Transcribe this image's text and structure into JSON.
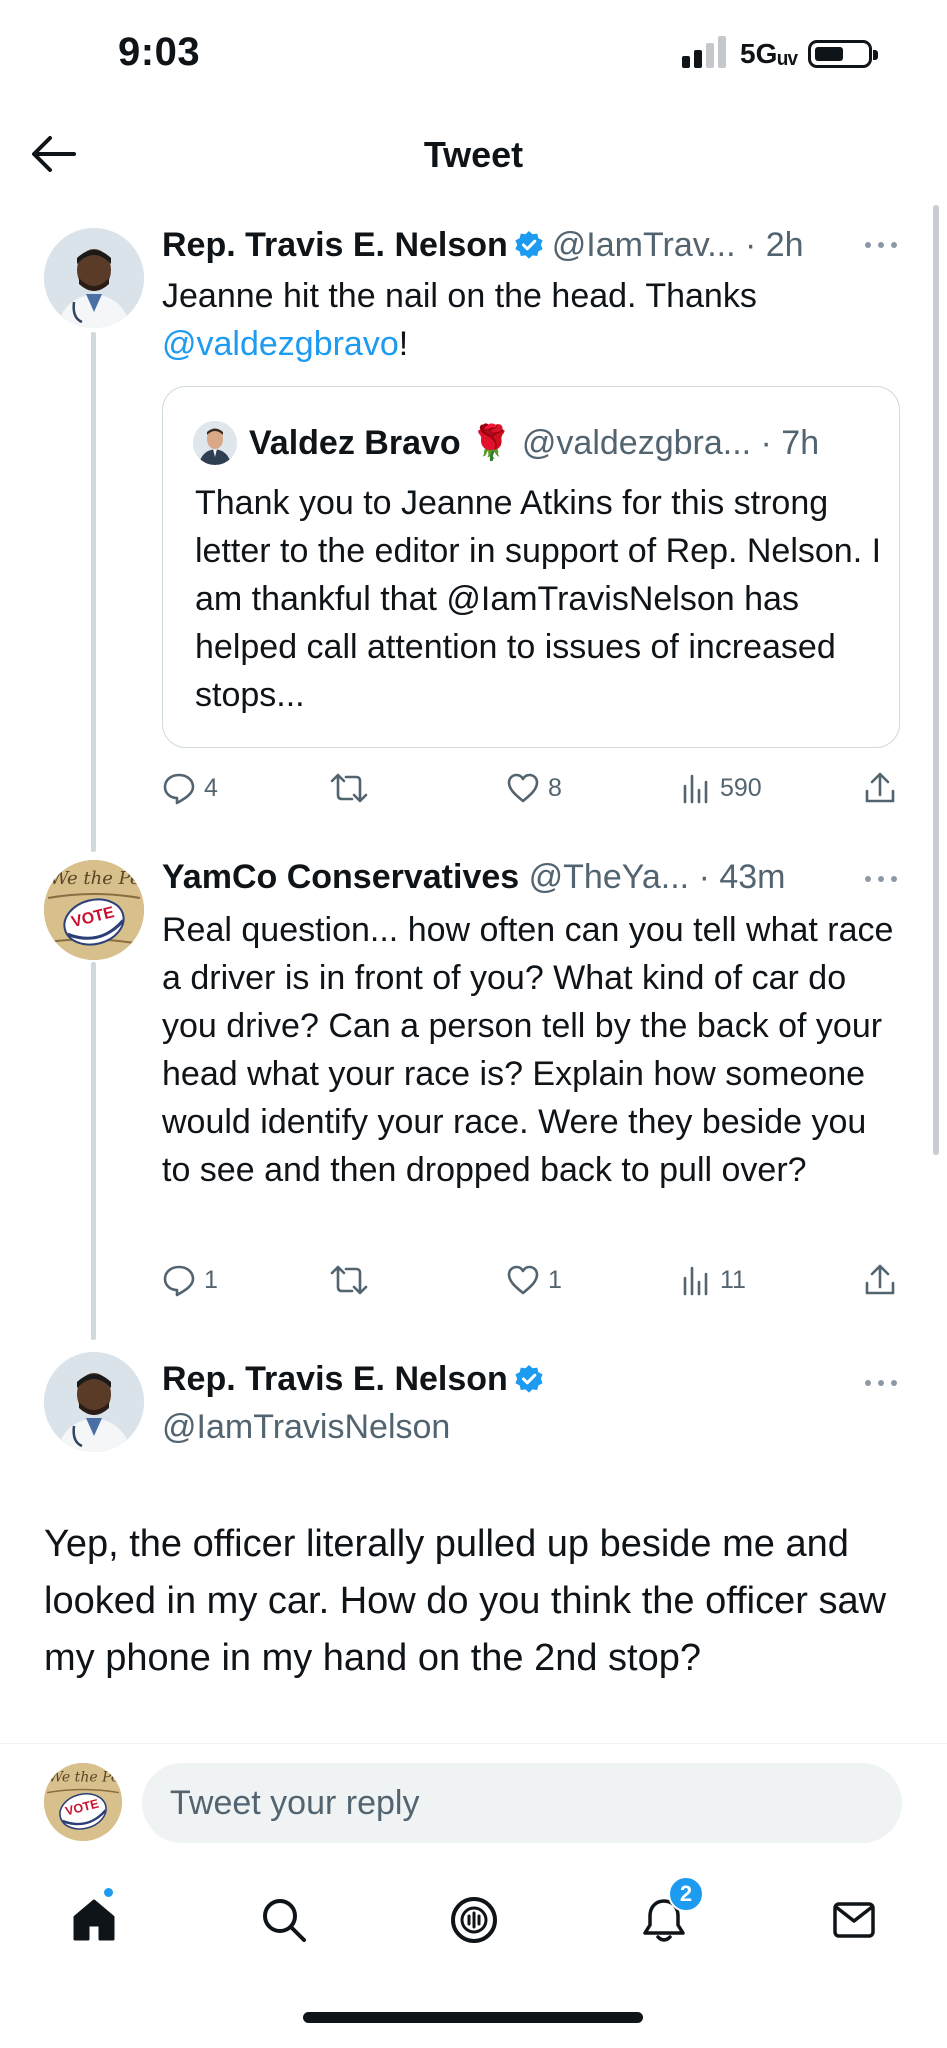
{
  "status_bar": {
    "time": "9:03",
    "network": "5Gᵤᵥ"
  },
  "header": {
    "title": "Tweet",
    "back_icon": "arrow-left-icon"
  },
  "tweets": [
    {
      "name": "Rep. Travis E. Nelson",
      "verified": true,
      "meta": "@IamTrav... · 2h",
      "text_before": "Jeanne hit the nail on the head. Thanks ",
      "mention": "@valdezgbravo",
      "text_after": "!",
      "quote": {
        "name": "Valdez Bravo",
        "emoji": "🌹",
        "meta": "@valdezgbra... · 7h",
        "text": "Thank you to Jeanne Atkins for this strong letter to the editor in support of Rep. Nelson. I am thankful that @IamTravisNelson has helped call attention to issues of increased stops..."
      },
      "stats": {
        "replies": "4",
        "retweets": "",
        "likes": "8",
        "views": "590"
      }
    },
    {
      "name": "YamCo Conservatives",
      "verified": false,
      "meta": "@TheYa... · 43m",
      "text": "Real question... how often can you tell what race a driver is in front of you? What kind of car do you drive? Can a person tell by the back of your head what your race is? Explain how someone would identify your race. Were they beside you to see and then dropped back to pull over?",
      "stats": {
        "replies": "1",
        "retweets": "",
        "likes": "1",
        "views": "11"
      }
    }
  ],
  "main_tweet": {
    "name": "Rep. Travis E. Nelson",
    "verified": true,
    "handle": "@IamTravisNelson",
    "text": "Yep, the officer literally pulled up beside me and looked in my car. How do you think the officer saw my phone in my hand on the 2nd stop?"
  },
  "reply": {
    "placeholder": "Tweet your reply"
  },
  "tabbar": {
    "items": [
      "home-icon",
      "search-icon",
      "spaces-icon",
      "notifications-icon",
      "messages-icon"
    ],
    "notifications_badge": "2"
  },
  "colors": {
    "accent": "#1d9bf0",
    "text": "#0f1419",
    "muted": "#536471",
    "border": "#cfd9de"
  }
}
